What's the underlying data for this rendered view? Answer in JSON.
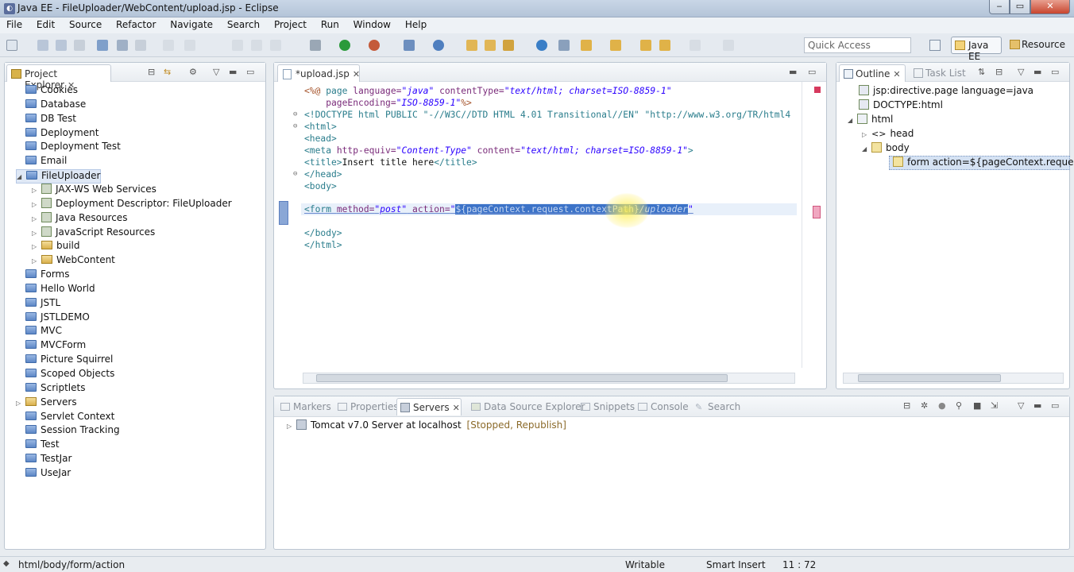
{
  "window": {
    "title": "Java EE - FileUploader/WebContent/upload.jsp - Eclipse"
  },
  "menu": [
    "File",
    "Edit",
    "Source",
    "Refactor",
    "Navigate",
    "Search",
    "Project",
    "Run",
    "Window",
    "Help"
  ],
  "toolbar": {
    "quick_access_placeholder": "Quick Access",
    "perspective_active": "Java EE",
    "perspective_other": "Resource"
  },
  "project_explorer": {
    "title": "Project Explorer",
    "items": [
      {
        "label": "Cookies",
        "level": 0,
        "type": "project"
      },
      {
        "label": "Database",
        "level": 0,
        "type": "project"
      },
      {
        "label": "DB Test",
        "level": 0,
        "type": "project"
      },
      {
        "label": "Deployment",
        "level": 0,
        "type": "project"
      },
      {
        "label": "Deployment Test",
        "level": 0,
        "type": "project"
      },
      {
        "label": "Email",
        "level": 0,
        "type": "project"
      },
      {
        "label": "FileUploader",
        "level": 0,
        "type": "project",
        "expanded": true,
        "selected": true
      },
      {
        "label": "JAX-WS Web Services",
        "level": 1,
        "type": "node"
      },
      {
        "label": "Deployment Descriptor: FileUploader",
        "level": 1,
        "type": "node"
      },
      {
        "label": "Java Resources",
        "level": 1,
        "type": "node"
      },
      {
        "label": "JavaScript Resources",
        "level": 1,
        "type": "node"
      },
      {
        "label": "build",
        "level": 1,
        "type": "folder"
      },
      {
        "label": "WebContent",
        "level": 1,
        "type": "folder"
      },
      {
        "label": "Forms",
        "level": 0,
        "type": "project"
      },
      {
        "label": "Hello World",
        "level": 0,
        "type": "project"
      },
      {
        "label": "JSTL",
        "level": 0,
        "type": "project"
      },
      {
        "label": "JSTLDEMO",
        "level": 0,
        "type": "project"
      },
      {
        "label": "MVC",
        "level": 0,
        "type": "project"
      },
      {
        "label": "MVCForm",
        "level": 0,
        "type": "project"
      },
      {
        "label": "Picture Squirrel",
        "level": 0,
        "type": "project"
      },
      {
        "label": "Scoped Objects",
        "level": 0,
        "type": "project"
      },
      {
        "label": "Scriptlets",
        "level": 0,
        "type": "project"
      },
      {
        "label": "Servers",
        "level": 0,
        "type": "folder-collapsed"
      },
      {
        "label": "Servlet Context",
        "level": 0,
        "type": "project"
      },
      {
        "label": "Session Tracking",
        "level": 0,
        "type": "project"
      },
      {
        "label": "Test",
        "level": 0,
        "type": "project"
      },
      {
        "label": "TestJar",
        "level": 0,
        "type": "project"
      },
      {
        "label": "UseJar",
        "level": 0,
        "type": "project"
      }
    ]
  },
  "editor": {
    "tab_label": "*upload.jsp",
    "code": {
      "l1_a": "<%@ ",
      "l1_b": "page ",
      "l1_c": "language=",
      "l1_d": "\"java\"",
      "l1_e": " contentType=",
      "l1_f": "\"text/html; charset=ISO-8859-1\"",
      "l2_a": "    pageEncoding=",
      "l2_b": "\"ISO-8859-1\"",
      "l2_c": "%>",
      "l3": "<!DOCTYPE html PUBLIC \"-//W3C//DTD HTML 4.01 Transitional//EN\" \"http://www.w3.org/TR/html4",
      "l4": "<html>",
      "l5": "<head>",
      "l6_a": "<meta ",
      "l6_b": "http-equiv=",
      "l6_c": "\"Content-Type\"",
      "l6_d": " content=",
      "l6_e": "\"text/html; charset=ISO-8859-1\"",
      "l6_f": ">",
      "l7_a": "<title>",
      "l7_b": "Insert title here",
      "l7_c": "</title>",
      "l8": "</head>",
      "l9": "<body>",
      "l11_a": "<form ",
      "l11_b": "method=",
      "l11_c": "\"post\"",
      "l11_d": " action=",
      "l11_e": "\"",
      "l11_f": "${pageContext.request.contextPath}",
      "l11_g": "/uploader",
      "l11_h": "\"",
      "l13": "</body>",
      "l14": "</html>"
    }
  },
  "outline": {
    "title": "Outline",
    "other_tab": "Task List",
    "items": [
      {
        "label": "jsp:directive.page language=java"
      },
      {
        "label": "DOCTYPE:html"
      },
      {
        "label": "html"
      },
      {
        "label": "head"
      },
      {
        "label": "body"
      },
      {
        "label": "form action=${pageContext.request.co"
      }
    ]
  },
  "bottom_panel": {
    "tabs": [
      "Markers",
      "Properties",
      "Servers",
      "Data Source Explorer",
      "Snippets",
      "Console",
      "Search"
    ],
    "active_tab": "Servers",
    "server_name": "Tomcat v7.0 Server at localhost",
    "server_state": "[Stopped, Republish]"
  },
  "status_bar": {
    "path": "html/body/form/action",
    "mode": "Writable",
    "insert": "Smart Insert",
    "position": "11 : 72"
  }
}
